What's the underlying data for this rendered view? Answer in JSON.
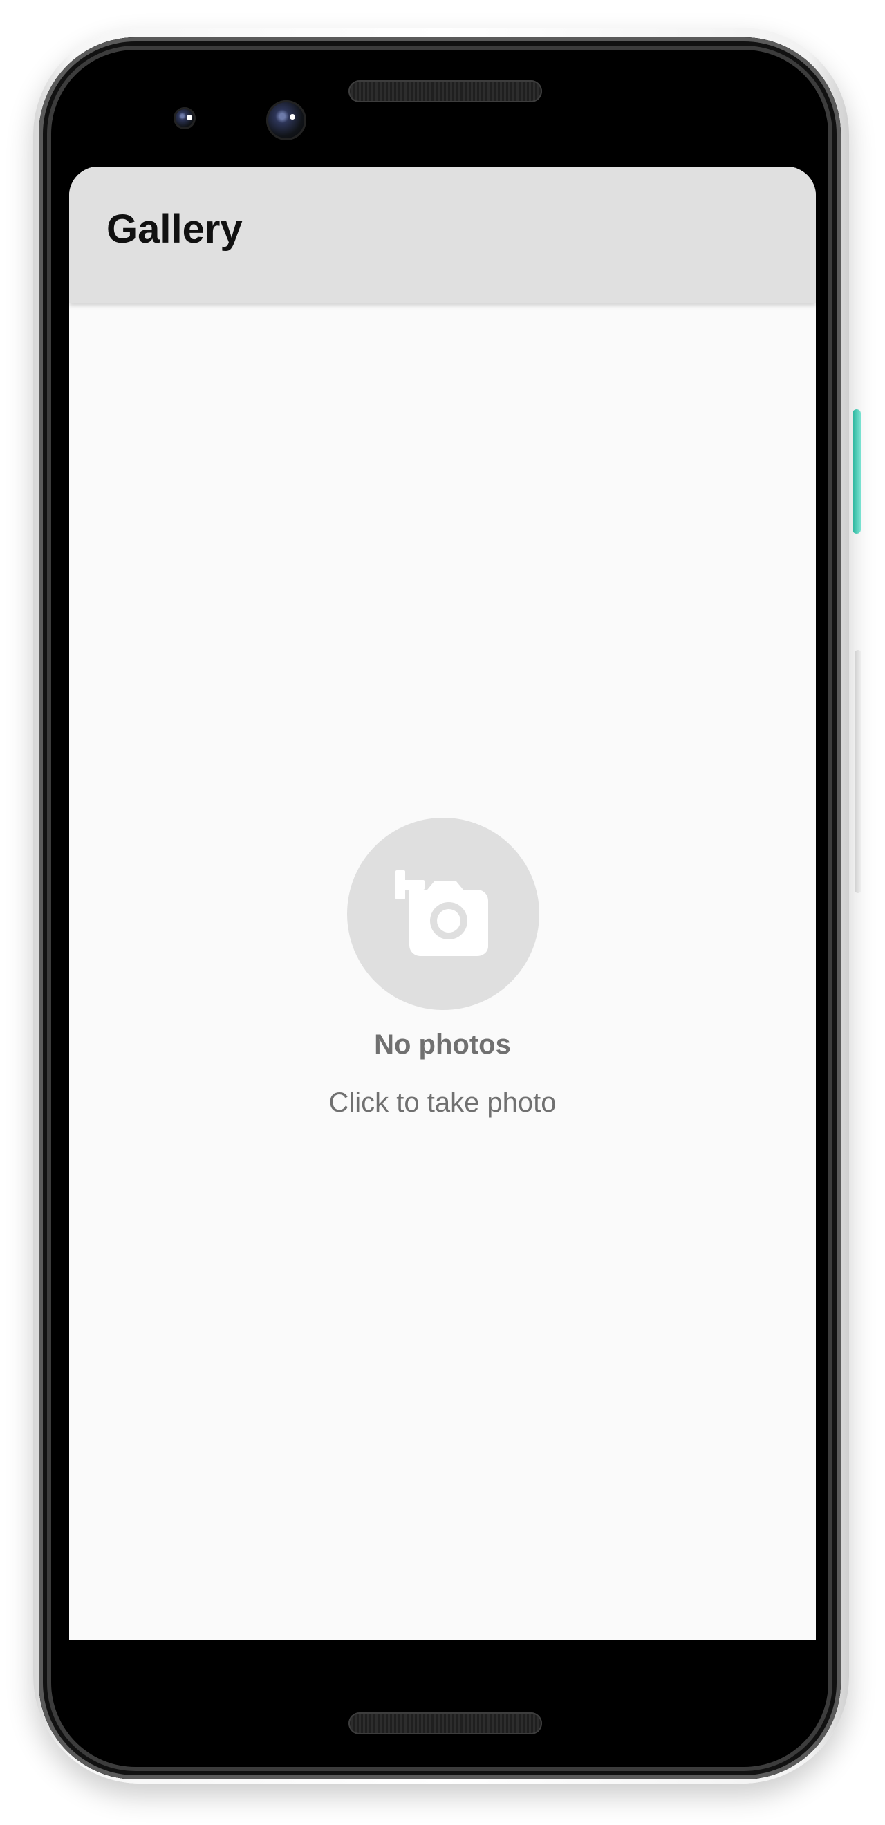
{
  "app": {
    "title": "Gallery"
  },
  "empty_state": {
    "title": "No photos",
    "subtitle": "Click to take photo",
    "icon": "add-photo-camera-icon"
  },
  "colors": {
    "app_bar": "#e0e0e0",
    "screen_background": "#fafafa",
    "empty_circle": "#dfdfdf",
    "empty_text": "#707070",
    "phone_accent": "#2fbca5"
  }
}
